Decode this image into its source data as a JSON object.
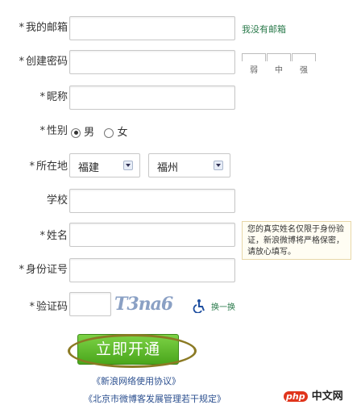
{
  "form": {
    "email_label": "我的邮箱",
    "no_email_link": "我没有邮箱",
    "password_label": "创建密码",
    "strength": [
      "弱",
      "中",
      "强"
    ],
    "nickname_label": "昵称",
    "gender_label": "性别",
    "gender_options": [
      "男",
      "女"
    ],
    "location_label": "所在地",
    "province_value": "福建",
    "city_value": "福州",
    "school_label": "学校",
    "name_label": "姓名",
    "name_tip": "您的真实姓名仅限于身份验证，新浪微博将严格保密，请放心填写。",
    "id_label": "身份证号",
    "captcha_label": "验证码",
    "captcha_text": "T3na6",
    "refresh_link": "换一换",
    "submit_label": "立即开通",
    "terms_link": "《新浪网络使用协议》",
    "regulation_link": "《北京市微博客发展管理若干规定》"
  },
  "watermark": {
    "php_text": "php",
    "site_text": "中文网"
  },
  "colors": {
    "accent_green": "#4aa61c",
    "link_blue": "#2b4f8f",
    "link_green": "#2a7a4b"
  }
}
